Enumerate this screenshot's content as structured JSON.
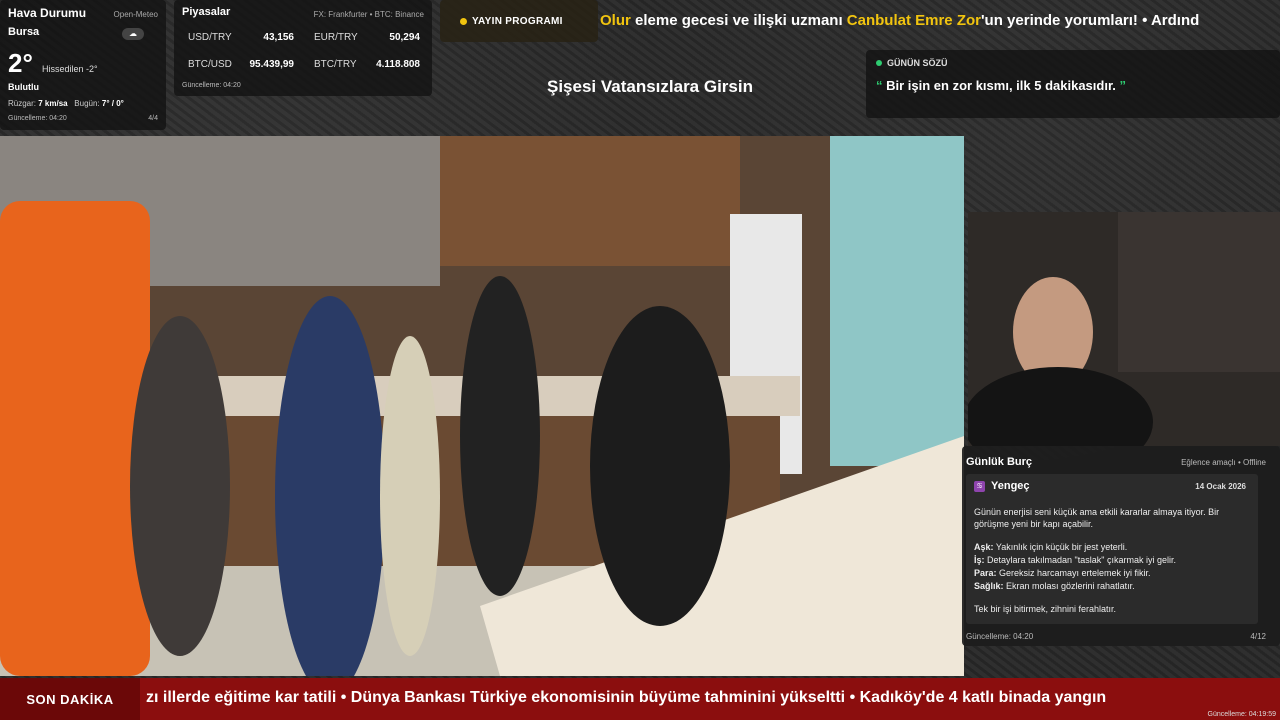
{
  "weather": {
    "title": "Hava Durumu",
    "source": "Open-Meteo",
    "city": "Bursa",
    "temp": "2°",
    "feels": "Hissedilen -2°",
    "condition": "Bulutlu",
    "wind_label": "Rüzgar:",
    "wind_value": "7 km/sa",
    "today_label": "Bugün:",
    "today_value": "7° / 0°",
    "updated": "Güncelleme: 04:20",
    "page": "4/4"
  },
  "markets": {
    "title": "Piyasalar",
    "source": "FX: Frankfurter • BTC: Binance",
    "rows": [
      {
        "k": "USD/TRY",
        "v": "43,156"
      },
      {
        "k": "EUR/TRY",
        "v": "50,294"
      },
      {
        "k": "BTC/USD",
        "v": "95.439,99"
      },
      {
        "k": "BTC/TRY",
        "v": "4.118.808"
      }
    ],
    "updated": "Güncelleme: 04:20"
  },
  "schedule": {
    "label": "YAYIN PROGRAMI"
  },
  "top_ticker": {
    "parts": [
      {
        "t": "Olur",
        "hl": true
      },
      {
        "t": " eleme gecesi ve ilişki uzmanı ",
        "hl": false
      },
      {
        "t": "Canbulat Emre Zor",
        "hl": true
      },
      {
        "t": "'un yerinde yorumları!  •  Ardınd",
        "hl": false
      }
    ]
  },
  "show_title": "Şişesi Vatansızlara Girsin",
  "quote": {
    "label": "GÜNÜN SÖZÜ",
    "text": "Bir işin en zor kısmı, ilk 5 dakikasıdır.",
    "open": "“",
    "close": "”"
  },
  "horoscope": {
    "title": "Günlük Burç",
    "meta": "Eğlence amaçlı • Offline",
    "sign": "Yengeç",
    "date": "14 Ocak 2026",
    "intro": "Günün enerjisi seni küçük ama etkili kararlar almaya itiyor. Bir görüşme yeni bir kapı açabilir.",
    "items": [
      {
        "k": "Aşk:",
        "v": " Yakınlık için küçük bir jest yeterli."
      },
      {
        "k": "İş:",
        "v": " Detaylara takılmadan \"taslak\" çıkarmak iyi gelir."
      },
      {
        "k": "Para:",
        "v": " Gereksiz harcamayı ertelemek iyi fikir."
      },
      {
        "k": "Sağlık:",
        "v": " Ekran molası gözlerini rahatlatır."
      }
    ],
    "closing": "Tek bir işi bitirmek, zihnini ferahlatır.",
    "updated": "Güncelleme: 04:20",
    "page": "4/12"
  },
  "breaking": {
    "label": "SON DAKİKA",
    "text": "zı illerde eğitime kar tatili  •  Dünya Bankası Türkiye ekonomisinin büyüme tahminini yükseltti  •  Kadıköy'de 4 katlı binada yangın",
    "stamp": "Güncelleme: 04:19:59"
  },
  "colors": {
    "accent_yellow": "#f1c40f",
    "accent_green": "#2ecc71",
    "breaking_red": "#8b0e0e"
  }
}
